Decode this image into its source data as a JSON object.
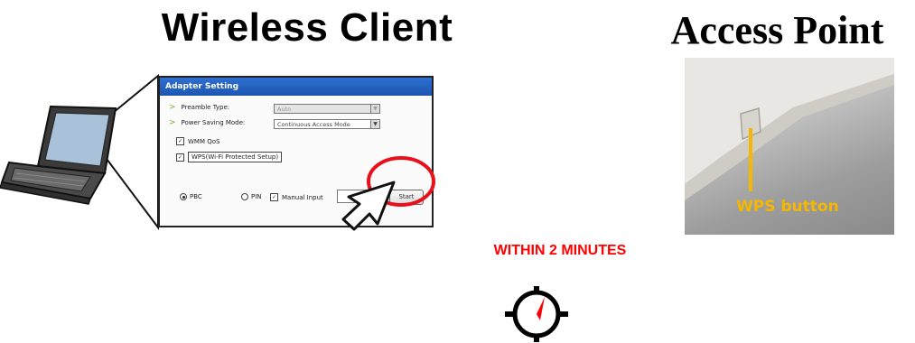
{
  "headings": {
    "client": "Wireless Client",
    "access_point": "Access Point"
  },
  "dialog": {
    "title": "Adapter Setting",
    "preamble_label": "Preamble Type:",
    "preamble_value": "Auto",
    "power_label": "Power Saving Mode:",
    "power_value": "Continuous Access Mode",
    "wmm_label": "WMM QoS",
    "wps_label": "WPS(Wi-Fi Protected Setup)",
    "pbc_label": "PBC",
    "pin_label": "PIN",
    "manual_label": "Manual Input",
    "start_label": "Start"
  },
  "photo": {
    "wps_button_label": "WPS button"
  },
  "timing": {
    "within_label": "WITHIN 2 MINUTES"
  },
  "colors": {
    "accent_red": "#ff0000",
    "wps_yellow": "#f5b700",
    "dialog_titlebar": "#2e6fd1"
  },
  "icons": [
    "laptop-icon",
    "pointer-cursor-icon",
    "stopwatch-icon"
  ]
}
